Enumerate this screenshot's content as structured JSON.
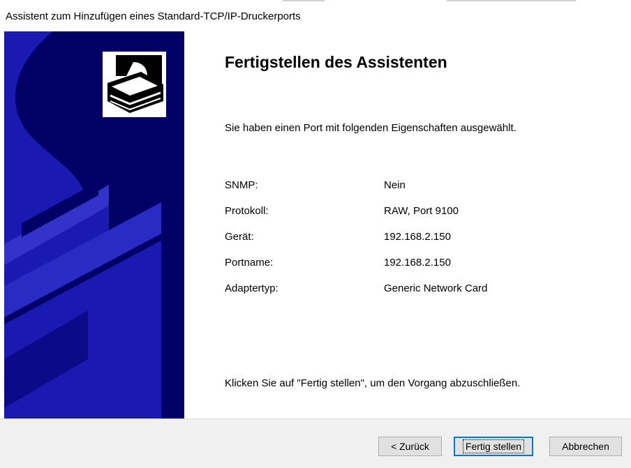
{
  "window": {
    "title": "Assistent zum Hinzufügen eines Standard-TCP/IP-Druckerports"
  },
  "main": {
    "heading": "Fertigstellen des Assistenten",
    "intro": "Sie haben einen Port mit folgenden Eigenschaften ausgewählt.",
    "properties": [
      {
        "label": "SNMP:",
        "value": "Nein"
      },
      {
        "label": "Protokoll:",
        "value": "RAW, Port 9100"
      },
      {
        "label": "Gerät:",
        "value": "192.168.2.150"
      },
      {
        "label": "Portname:",
        "value": "192.168.2.150"
      },
      {
        "label": "Adaptertyp:",
        "value": "Generic Network Card"
      }
    ],
    "footer": "Klicken Sie auf \"Fertig stellen\", um den Vorgang abzuschließen."
  },
  "buttons": {
    "back": "< Zurück",
    "finish": "Fertig stellen",
    "cancel": "Abbrechen"
  },
  "colors": {
    "side_panel": "#000066",
    "side_shape": "#1a1ab3",
    "default_button_border": "#0078d7",
    "button_bar": "#f0f0f0"
  },
  "icons": {
    "wizard_graphic": "printer-wizard-graphic",
    "badge": "printer-icon"
  }
}
